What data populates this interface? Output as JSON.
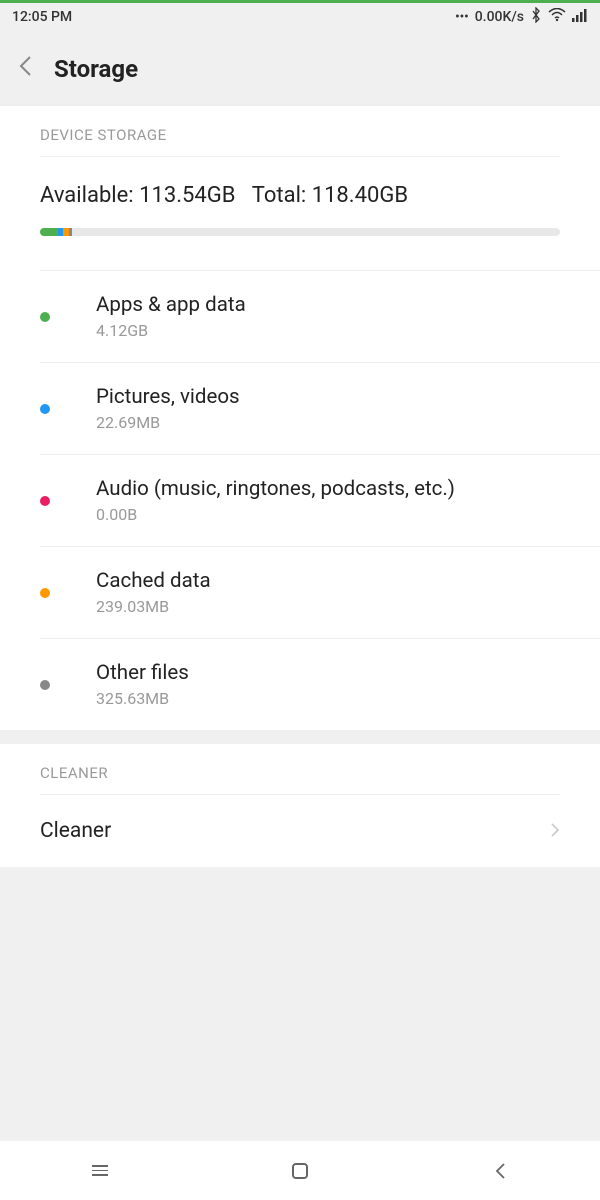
{
  "statusBar": {
    "time": "12:05 PM",
    "dataRate": "0.00K/s"
  },
  "header": {
    "title": "Storage"
  },
  "deviceStorage": {
    "sectionLabel": "DEVICE STORAGE",
    "availableLabel": "Available: 113.54GB",
    "totalLabel": "Total: 118.40GB"
  },
  "categories": [
    {
      "color": "green",
      "title": "Apps & app data",
      "size": "4.12GB"
    },
    {
      "color": "blue",
      "title": "Pictures, videos",
      "size": "22.69MB"
    },
    {
      "color": "pink",
      "title": "Audio (music, ringtones, podcasts, etc.)",
      "size": "0.00B"
    },
    {
      "color": "orange",
      "title": "Cached data",
      "size": "239.03MB"
    },
    {
      "color": "grey",
      "title": "Other files",
      "size": "325.63MB"
    }
  ],
  "cleaner": {
    "sectionLabel": "CLEANER",
    "itemLabel": "Cleaner"
  }
}
